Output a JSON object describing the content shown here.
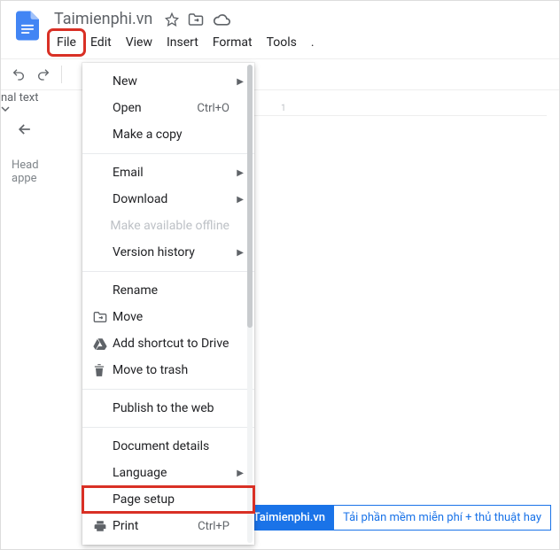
{
  "doc": {
    "title": "Taimienphi.vn"
  },
  "menubar": {
    "file": "File",
    "edit": "Edit",
    "view": "View",
    "insert": "Insert",
    "format": "Format",
    "tools": "Tools",
    "more": "."
  },
  "toolbar": {
    "format_select": "nal text",
    "ruler_tick": "1"
  },
  "outline": {
    "line1": "Head",
    "line2": "appe"
  },
  "dropdown": {
    "new": "New",
    "open": "Open",
    "open_shortcut": "Ctrl+O",
    "make_copy": "Make a copy",
    "email": "Email",
    "download": "Download",
    "offline": "Make available offline",
    "version_history": "Version history",
    "rename": "Rename",
    "move": "Move",
    "add_shortcut": "Add shortcut to Drive",
    "trash": "Move to trash",
    "publish": "Publish to the web",
    "doc_details": "Document details",
    "language": "Language",
    "page_setup": "Page setup",
    "print": "Print",
    "print_shortcut": "Ctrl+P"
  },
  "watermark": {
    "brand": "Taimienphi.vn",
    "tagline": "Tải phần mềm miễn phí + thủ thuật hay"
  }
}
